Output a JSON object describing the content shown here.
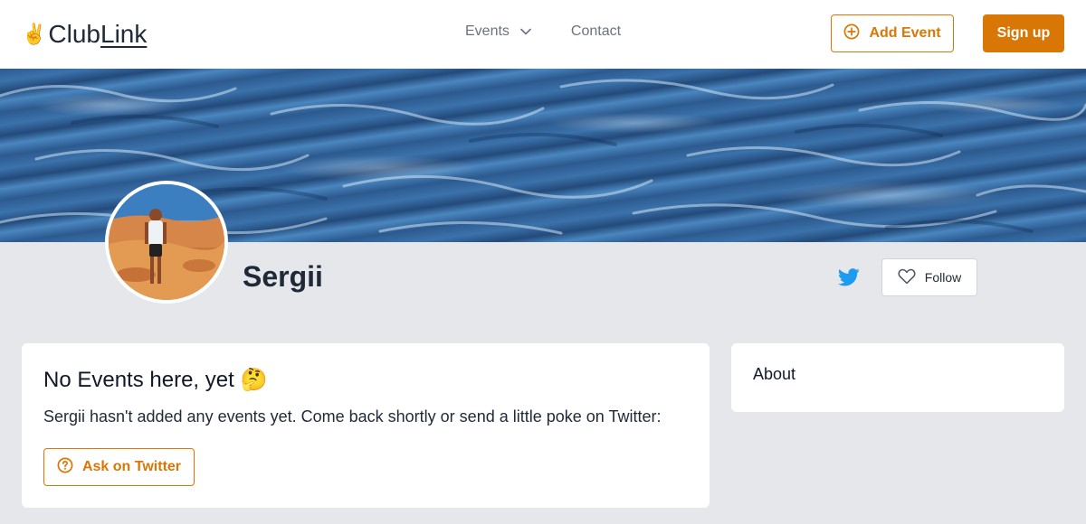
{
  "brand": {
    "logo_emoji": "✌️",
    "logo_club": "Club",
    "logo_link": "Link"
  },
  "nav": {
    "events_label": "Events",
    "contact_label": "Contact",
    "add_event_label": "Add Event",
    "signup_label": "Sign up"
  },
  "profile": {
    "name": "Sergii",
    "follow_label": "Follow"
  },
  "events_card": {
    "heading": "No Events here, yet 🤔",
    "message": "Sergii hasn't added any events yet. Come back shortly or send a little poke on Twitter:",
    "ask_button_label": "Ask on Twitter"
  },
  "about_card": {
    "heading": "About"
  },
  "colors": {
    "accent": "#d97706",
    "twitter": "#1d9bf0",
    "background": "#e5e7eb"
  },
  "icons": {
    "events_chevron": "chevron-down-icon",
    "add_event": "plus-circle-icon",
    "twitter": "twitter-icon",
    "follow": "heart-icon",
    "ask": "question-circle-icon"
  }
}
